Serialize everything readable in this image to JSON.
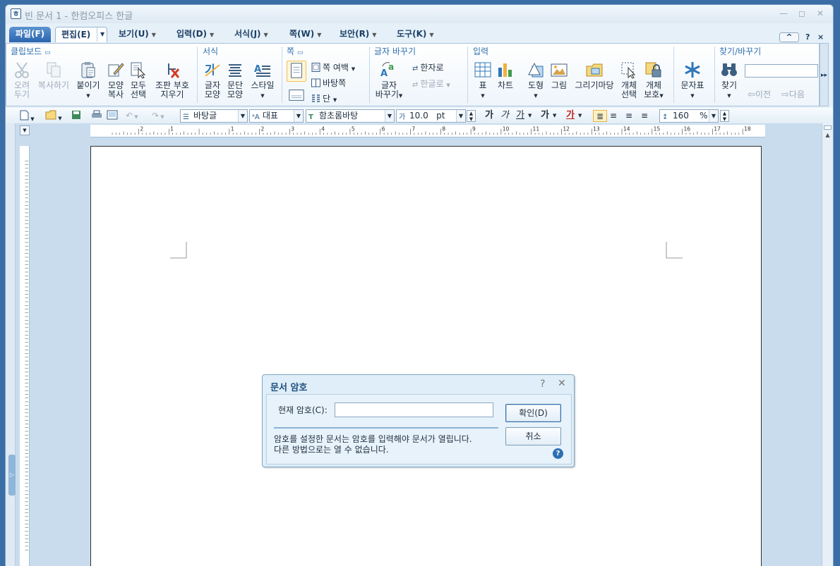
{
  "window": {
    "title": "빈 문서 1 - 한컴오피스 한글",
    "app_icon": "hwp-icon",
    "controls": {
      "minimize": "—",
      "restore": "◻",
      "close": "✕"
    }
  },
  "menubar": {
    "items": [
      {
        "label": "파일(F)"
      },
      {
        "label": "편집(E)"
      },
      {
        "label": "보기(U)"
      },
      {
        "label": "입력(D)"
      },
      {
        "label": "서식(J)"
      },
      {
        "label": "쪽(W)"
      },
      {
        "label": "보안(R)"
      },
      {
        "label": "도구(K)"
      }
    ],
    "collapse": "^",
    "help": "?",
    "close": "×"
  },
  "ribbon": {
    "groups": {
      "clipboard": "클립보드",
      "format": "서식",
      "page": "쪽",
      "charchange": "글자 바꾸기",
      "input": "입력",
      "find": "찾기/바꾸기"
    },
    "clipboard": {
      "cut_l1": "오려",
      "cut_l2": "두기",
      "copy": "복사하기",
      "paste": "붙이기",
      "fmtcopy_l1": "모양",
      "fmtcopy_l2": "복사",
      "selall_l1": "모두",
      "selall_l2": "선택",
      "clearmark_l1": "조판 부호",
      "clearmark_l2": "지우기"
    },
    "format": {
      "char_l1": "글자",
      "char_l2": "모양",
      "para_l1": "문단",
      "para_l2": "모양",
      "style": "스타일"
    },
    "page": {
      "margin": "쪽 여백",
      "bg": "바탕쪽",
      "col": "단"
    },
    "charchange": {
      "l1": "글자",
      "l2": "바꾸기",
      "hanja": "한자로",
      "hangul": "한글로"
    },
    "input": {
      "table": "표",
      "chart": "차트",
      "shape": "도형",
      "picture": "그림",
      "gallery": "그리기마당",
      "objsel_l1": "개체",
      "objsel_l2": "선택",
      "objprot_l1": "개체",
      "objprot_l2": "보호",
      "symbol": "문자표"
    },
    "find": {
      "find": "찾기",
      "prev": "이전",
      "next": "다음",
      "input_value": ""
    }
  },
  "toolbar": {
    "style": "바탕글",
    "lang": "대표",
    "font": "함초롬바탕",
    "size": "10.0",
    "size_unit": "pt",
    "bold": "가",
    "italic": "가",
    "underline": "가",
    "strike": "가",
    "color": "가",
    "line_spacing": "160",
    "line_spacing_unit": "%"
  },
  "dialog": {
    "title": "문서 암호",
    "help": "?",
    "close": "✕",
    "pw_label": "현재 암호(C):",
    "pw_value": "",
    "message_l1": "암호를 설정한 문서는 암호를 입력해야 문서가 열립니다.",
    "message_l2": "다른 방법으로는 열 수 없습니다.",
    "ok": "확인(D)",
    "cancel": "취소",
    "info": "?"
  },
  "colors": {
    "accent": "#2f6fae",
    "file_tab": "#2a64ad",
    "frame": "#e5f0f8",
    "workspace": "#c8dced"
  }
}
